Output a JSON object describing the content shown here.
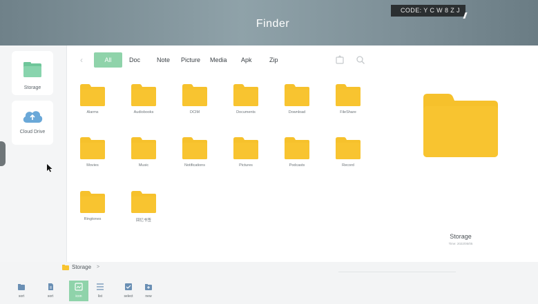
{
  "header": {
    "title": "Finder",
    "code_label": "CODE: Y C W 8 Z J"
  },
  "sidebar": {
    "items": [
      {
        "label": "Storage",
        "icon": "storage-icon"
      },
      {
        "label": "Cloud Drive",
        "icon": "cloud-icon"
      }
    ]
  },
  "tabs": [
    {
      "label": "All"
    },
    {
      "label": "Doc"
    },
    {
      "label": "Note"
    },
    {
      "label": "Picture"
    },
    {
      "label": "Media"
    },
    {
      "label": "Apk"
    },
    {
      "label": "Zip"
    }
  ],
  "folders": [
    "Alarms",
    "Audiobooks",
    "DCIM",
    "Documents",
    "Download",
    "FileShare",
    "Movies",
    "Music",
    "Notifications",
    "Pictures",
    "Podcasts",
    "Record",
    "Ringtones",
    "回忆书签"
  ],
  "preview": {
    "name": "Storage",
    "time": "Time: 2022/05/05"
  },
  "breadcrumb": {
    "label": "Storage",
    "separator": ">"
  },
  "toolbar": {
    "buttons": [
      {
        "label": "sort",
        "icon": "folder-sort-icon"
      },
      {
        "label": "sort",
        "icon": "file-sort-icon"
      },
      {
        "label": "icon",
        "icon": "grid-view-icon"
      },
      {
        "label": "list",
        "icon": "list-view-icon"
      },
      {
        "label": "select",
        "icon": "select-icon"
      },
      {
        "label": "new",
        "icon": "new-folder-icon"
      }
    ]
  },
  "colors": {
    "accent": "#8fd3aa",
    "folder": "#f8c430",
    "header": "#7d8f97"
  }
}
